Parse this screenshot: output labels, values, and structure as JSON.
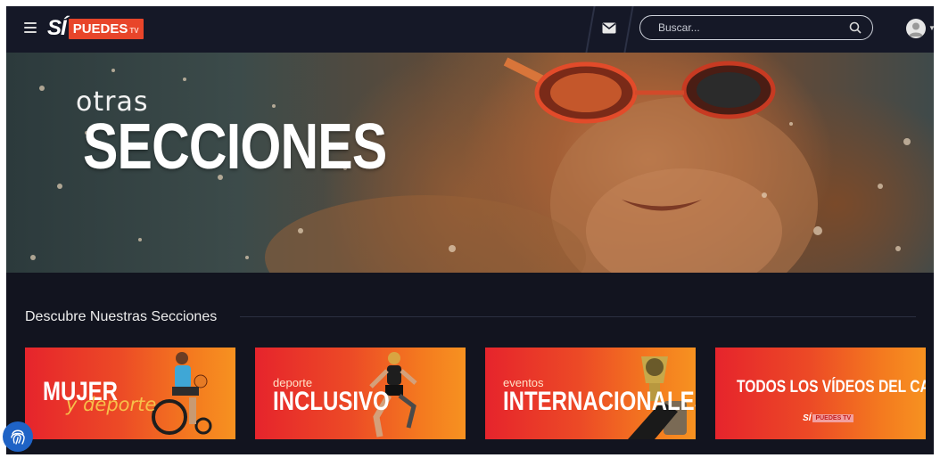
{
  "header": {
    "logo_si": "SÍ",
    "logo_box": "PUEDES",
    "logo_tv": "TV",
    "search_placeholder": "Buscar..."
  },
  "hero": {
    "small": "otras",
    "title": "SECCIONES"
  },
  "section": {
    "title": "Descubre Nuestras Secciones"
  },
  "cards": [
    {
      "main": "MUJER",
      "sub": "y deporte"
    },
    {
      "sub": "deporte",
      "main": "INCLUSIVO"
    },
    {
      "sub": "eventos",
      "main": "INTERNACIONALES"
    },
    {
      "main": "TODOS LOS VÍDEOS DEL CANAL",
      "logo_si": "SÍ",
      "logo_box": "PUEDES TV"
    }
  ],
  "colors": {
    "accent": "#e8452a",
    "card_gradient_start": "#e6242c",
    "card_gradient_end": "#f79220",
    "background": "#12141f",
    "fingerprint_button": "#1f63c6"
  },
  "icons": {
    "menu": "hamburger-menu-icon",
    "mail": "envelope-icon",
    "search": "magnifier-icon",
    "user": "user-avatar-icon",
    "accessibility": "fingerprint-icon"
  }
}
